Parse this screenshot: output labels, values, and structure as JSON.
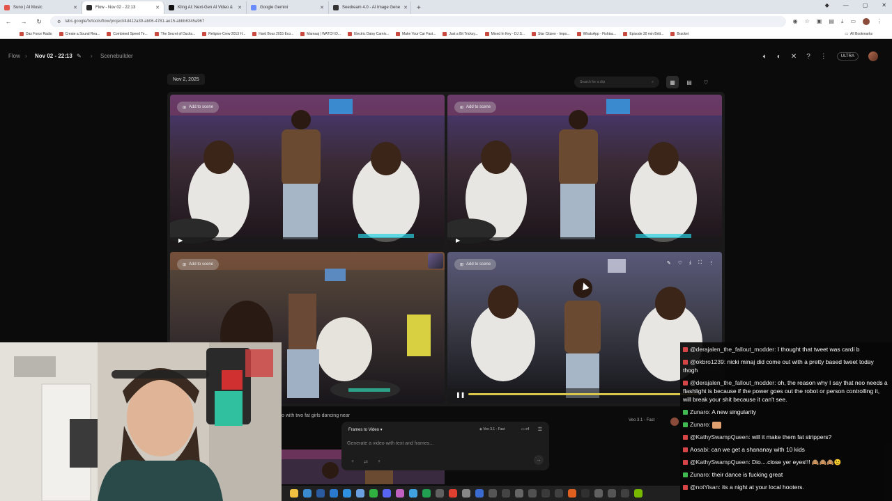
{
  "browser": {
    "tabs": [
      {
        "title": "Suno | AI Music",
        "color": "#e4544a",
        "active": false
      },
      {
        "title": "Flow - Nov 02 - 22:13",
        "color": "#2b2b2b",
        "active": true
      },
      {
        "title": "Kling AI: Next-Gen AI Video &",
        "color": "#111111",
        "active": false
      },
      {
        "title": "Google Gemini",
        "color": "#6b8cff",
        "active": false
      },
      {
        "title": "Seedream 4.0 - AI Image Gene",
        "color": "#333333",
        "active": false
      }
    ],
    "new_tab": "+",
    "url": "labs.google/fx/tools/flow/project/4d412a39-ab06-4781-ae15-abbb6345a967",
    "bookmarks": [
      "Das Force Radio",
      "Create a Sound Rea...",
      "Combined Speed Te...",
      "The Secret of Ducks...",
      "Religion-Crew 2013 H...",
      "Hard Boss 2015 Eco...",
      "Mamaaj | WATCH D...",
      "Electric Daisy Carniv...",
      "Make Your Car Fast...",
      "Just a Bit Tricksy...",
      "Mixed In Key - DJ S...",
      "Star Citizen - Impo...",
      "WhatsApp - Fishtac...",
      "Episode 30 min Britt...",
      "Bracket"
    ],
    "all_bookmarks": "All Bookmarks"
  },
  "header": {
    "crumb_root": "Flow",
    "project_title": "Nov 02 - 22:13",
    "crumb_section": "Scenebuilder",
    "plan_badge": "ULTRA"
  },
  "toolbar": {
    "date_label": "Nov 2, 2025",
    "search_placeholder": "Search for a clip"
  },
  "clips": [
    {
      "add_label": "Add to scene"
    },
    {
      "add_label": "Add to scene"
    },
    {
      "add_label": "Add to scene"
    },
    {
      "add_label": "Add to scene",
      "progress": 0.93
    }
  ],
  "prompt": {
    "prev_prompt": "o with two fat girls dancing near",
    "model_right": "Veo 3.1 - Fast",
    "mode": "Frames to Video",
    "model": "Veo 3.1 - Fast",
    "count": "x4",
    "placeholder": "Generate a video with text and frames..."
  },
  "chat": [
    {
      "badge": "#d64545",
      "user": "@derajalen_the_fallout_modder:",
      "text": " I thought that tweet was cardi b"
    },
    {
      "badge": "#d64545",
      "user": "@okbro1239:",
      "text": " nicki minaj did come out with a pretty based tweet today thogh"
    },
    {
      "badge": "#d64545",
      "user": "@derajalen_the_fallout_modder:",
      "text": " oh, the reason why I say that neo needs a flashlight is because if the power goes out the robot or person controlling it, will break your shit because it can't see."
    },
    {
      "badge": "#3fb950",
      "user": "Zunaro:",
      "text": " A new singularity"
    },
    {
      "badge": "#3fb950",
      "user": "Zunaro:",
      "text": " ",
      "emote": "#e0a070"
    },
    {
      "badge": "#d64545",
      "user": "@KathySwampQueen:",
      "text": " will it make them fat strippers?"
    },
    {
      "badge": "#d64545",
      "user": "Aosabi:",
      "text": " can we get a shananay with 10 kids"
    },
    {
      "badge": "#d64545",
      "user": "@KathySwampQueen:",
      "text": " Dio....close yer eyes!!! 🙈🙈🙈😉"
    },
    {
      "badge": "#3fb950",
      "user": "Zunaro:",
      "text": " their dance is fucking great"
    },
    {
      "badge": "#d64545",
      "user": "@notYisan:",
      "text": " its a night at your local hooters."
    }
  ],
  "icons": {
    "pencil": "pencil-icon",
    "volume": "volume-icon",
    "discord": "discord-icon",
    "x": "x-logo-icon",
    "help": "help-icon",
    "menu": "more-vert-icon",
    "grid": "grid-icon",
    "layout": "layout-icon",
    "heart": "heart-icon"
  },
  "colors": {
    "accent": "#d9c64a",
    "bg": "#0b0b0b",
    "panel": "#1c1c1c"
  }
}
